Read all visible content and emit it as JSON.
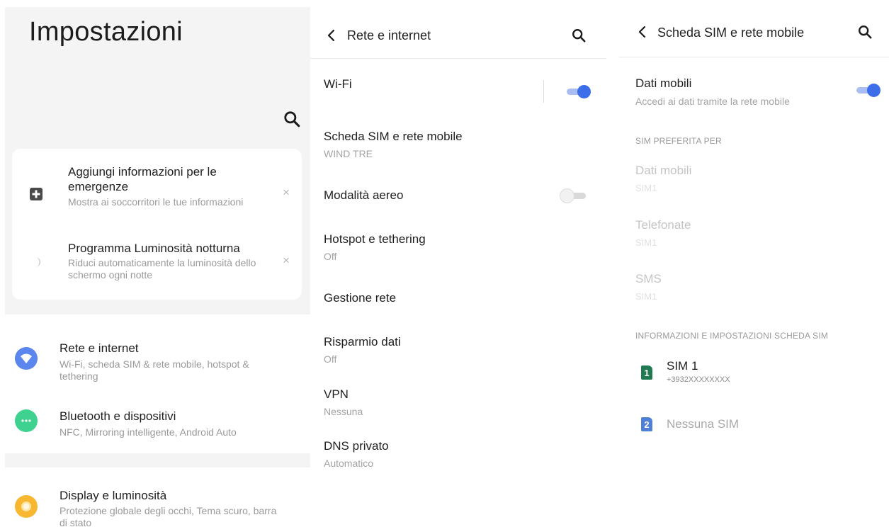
{
  "settings_main": {
    "title": "Impostazioni",
    "suggestions": [
      {
        "title": "Aggiungi informazioni per le emergenze",
        "subtitle": "Mostra ai soccorritori le tue informazioni",
        "dismiss": "×",
        "icon": "medical-plus-icon"
      },
      {
        "title": "Programma Luminosità notturna",
        "subtitle": "Riduci automaticamente la luminosità dello schermo ogni notte",
        "dismiss": "×",
        "icon": "moon-icon"
      }
    ],
    "items": [
      {
        "title": "Rete e internet",
        "subtitle": "Wi-Fi, scheda SIM & rete mobile, hotspot & tethering",
        "icon": "wifi-icon",
        "color": "#5b86ee"
      },
      {
        "title": "Bluetooth e dispositivi",
        "subtitle": "NFC, Mirroring intelligente, Android Auto",
        "icon": "more-dots-icon",
        "color": "#3ed18f"
      },
      {
        "title": "Display e luminosità",
        "subtitle": "Protezione globale degli occhi, Tema scuro, barra di stato",
        "icon": "brightness-icon",
        "color": "#f7b731"
      }
    ]
  },
  "network": {
    "title": "Rete e internet",
    "wifi": {
      "title": "Wi-Fi",
      "on": true
    },
    "sim": {
      "title": "Scheda SIM e rete mobile",
      "subtitle": "WIND TRE"
    },
    "airplane": {
      "title": "Modalità aereo",
      "on": false
    },
    "hotspot": {
      "title": "Hotspot e tethering",
      "subtitle": "Off"
    },
    "network_mgmt": {
      "title": "Gestione rete"
    },
    "data_saver": {
      "title": "Risparmio dati",
      "subtitle": "Off"
    },
    "vpn": {
      "title": "VPN",
      "subtitle": "Nessuna"
    },
    "dns": {
      "title": "DNS privato",
      "subtitle": "Automatico"
    }
  },
  "sim_page": {
    "title": "Scheda SIM e rete mobile",
    "mobile_data": {
      "title": "Dati mobili",
      "subtitle": "Accedi ai dati tramite la rete mobile",
      "on": true
    },
    "preferred_header": "SIM PREFERITA PER",
    "preferred": [
      {
        "title": "Dati mobili",
        "subtitle": "SIM1"
      },
      {
        "title": "Telefonate",
        "subtitle": "SIM1"
      },
      {
        "title": "SMS",
        "subtitle": "SIM1"
      }
    ],
    "info_header": "INFORMAZIONI E IMPOSTAZIONI SCHEDA SIM",
    "sim1": {
      "badge": "1",
      "title": "SIM 1",
      "number": "+3932XXXXXXXX",
      "color": "#1f7a52"
    },
    "sim2": {
      "badge": "2",
      "title": "Nessuna SIM",
      "color": "#4f7fd6"
    }
  },
  "colors": {
    "accent": "#3d6eea",
    "toggle_track_on": "#a9bdf3"
  }
}
